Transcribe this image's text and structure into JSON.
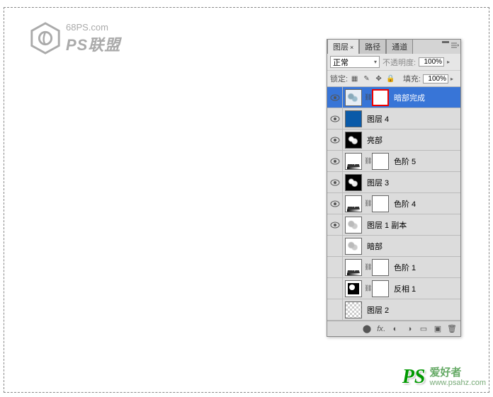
{
  "logo": {
    "url": "68PS.com",
    "name": "PS联盟"
  },
  "panel": {
    "tabs": {
      "layers": "图层",
      "paths": "路径",
      "channels": "通道"
    },
    "blend_mode": "正常",
    "opacity_label": "不透明度:",
    "opacity_value": "100%",
    "lock_label": "锁定:",
    "fill_label": "填充:",
    "fill_value": "100%"
  },
  "layers": [
    {
      "name": "暗部完成",
      "visible": true,
      "selected": true,
      "thumb": "ice",
      "mask": true,
      "redbox": true
    },
    {
      "name": "图层 4",
      "visible": true,
      "selected": false,
      "thumb": "solid-blue",
      "mask": false
    },
    {
      "name": "亮部",
      "visible": true,
      "selected": false,
      "thumb": "darkblobs",
      "mask": false
    },
    {
      "name": "色阶 5",
      "visible": true,
      "selected": false,
      "thumb": "levels",
      "mask": true
    },
    {
      "name": "图层 3",
      "visible": true,
      "selected": false,
      "thumb": "darkblobs",
      "mask": false
    },
    {
      "name": "色阶 4",
      "visible": true,
      "selected": false,
      "thumb": "levels",
      "mask": true
    },
    {
      "name": "图层 1 副本",
      "visible": true,
      "selected": false,
      "thumb": "grayblobs",
      "mask": false
    },
    {
      "name": "暗部",
      "visible": false,
      "selected": false,
      "thumb": "grayblobs",
      "mask": false
    },
    {
      "name": "色阶 1",
      "visible": false,
      "selected": false,
      "thumb": "levels",
      "mask": true
    },
    {
      "name": "反相 1",
      "visible": false,
      "selected": false,
      "thumb": "invert",
      "mask": true
    },
    {
      "name": "图层 2",
      "visible": false,
      "selected": false,
      "thumb": "transparent",
      "mask": false
    }
  ],
  "watermark": {
    "ps": "PS",
    "cn": "爱好者",
    "url": "www.psahz.com"
  }
}
